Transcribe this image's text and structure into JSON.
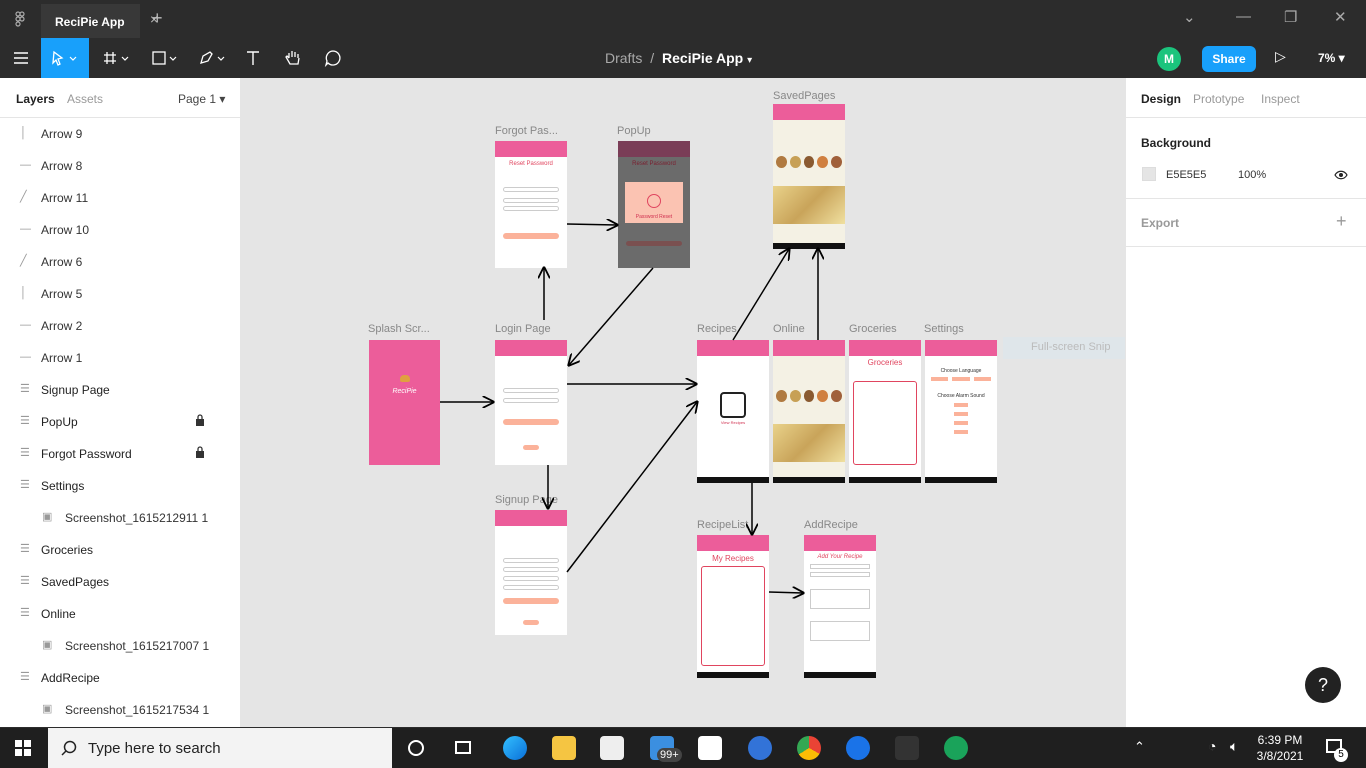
{
  "titlebar": {
    "tab_label": "ReciPie App"
  },
  "toolbar": {
    "breadcrumb_drafts": "Drafts",
    "breadcrumb_sep": "/",
    "file_name": "ReciPie App",
    "avatar_letter": "M",
    "share_label": "Share",
    "zoom_label": "7%"
  },
  "left_panel": {
    "tab_layers": "Layers",
    "tab_assets": "Assets",
    "page_selector": "Page 1",
    "layers": [
      {
        "label": "Arrow 9"
      },
      {
        "label": "Arrow 8"
      },
      {
        "label": "Arrow 11"
      },
      {
        "label": "Arrow 10"
      },
      {
        "label": "Arrow 6"
      },
      {
        "label": "Arrow 5"
      },
      {
        "label": "Arrow 2"
      },
      {
        "label": "Arrow 1"
      },
      {
        "label": "Signup Page"
      },
      {
        "label": "PopUp"
      },
      {
        "label": "Forgot Password"
      },
      {
        "label": "Settings"
      },
      {
        "label": "Screenshot_1615212911 1"
      },
      {
        "label": "Groceries"
      },
      {
        "label": "SavedPages"
      },
      {
        "label": "Online"
      },
      {
        "label": "Screenshot_1615217007 1"
      },
      {
        "label": "AddRecipe"
      },
      {
        "label": "Screenshot_1615217534 1"
      }
    ]
  },
  "canvas": {
    "frames": {
      "forgot": "Forgot Pas...",
      "popup": "PopUp",
      "saved": "SavedPages",
      "splash": "Splash Scr...",
      "login": "Login Page",
      "recipes": "Recipes",
      "online": "Online",
      "groceries": "Groceries",
      "settings": "Settings",
      "signup": "Signup Page",
      "recipelist": "RecipeList",
      "addrecipe": "AddRecipe"
    },
    "snip_label": "Full-screen Snip",
    "screens": {
      "reset_password": "Reset Password",
      "password_reset": "Password Reset",
      "splash_logo": "ReciPie",
      "view_recipes": "View Recipes",
      "groceries_title": "Groceries",
      "choose_language": "Choose Language",
      "choose_alarm": "Choose Alarm Sound",
      "my_recipes": "My Recipes",
      "add_your_recipe": "Add Your Recipe"
    }
  },
  "right_panel": {
    "tab_design": "Design",
    "tab_prototype": "Prototype",
    "tab_inspect": "Inspect",
    "background_heading": "Background",
    "background_hex": "E5E5E5",
    "background_opacity": "100%",
    "export_heading": "Export"
  },
  "taskbar": {
    "search_placeholder": "Type here to search",
    "mail_badge": "99+",
    "time": "6:39 PM",
    "date": "3/8/2021",
    "notification_count": "5"
  },
  "help_label": "?"
}
